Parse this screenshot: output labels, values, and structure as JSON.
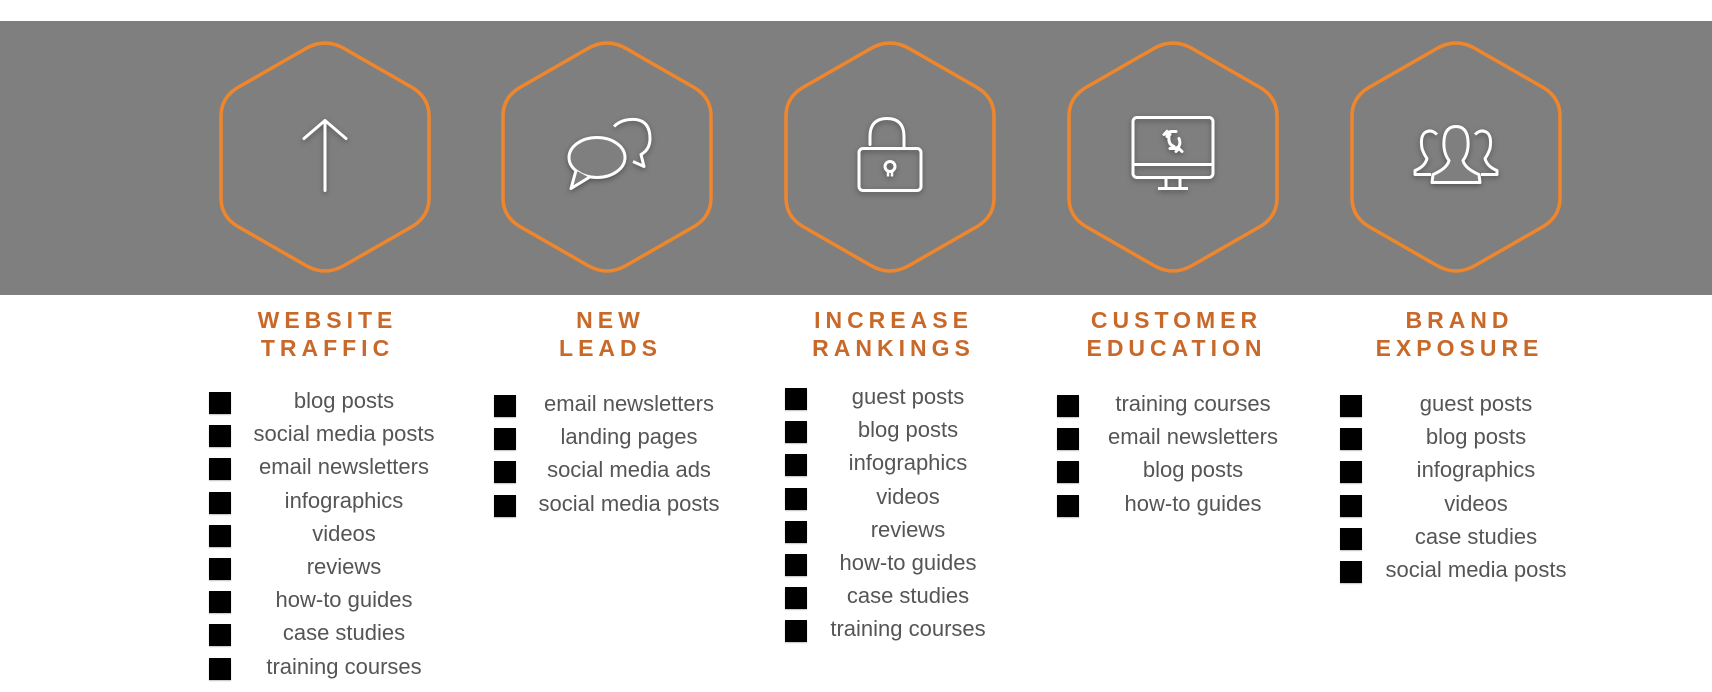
{
  "colors": {
    "band": "#7f7f7f",
    "hex_outline": "#f0862c",
    "title": "#c8692a",
    "item_text": "#555555",
    "bullet": "#000000",
    "icon": "#ffffff"
  },
  "goals": [
    {
      "icon": "arrow-up-icon",
      "title_line1": "WEBSITE",
      "title_line2": "TRAFFIC",
      "items": [
        "blog posts",
        "social media posts",
        "email newsletters",
        "infographics",
        "videos",
        "reviews",
        "how-to guides",
        "case studies",
        "training courses"
      ]
    },
    {
      "icon": "chat-bubbles-icon",
      "title_line1": "NEW",
      "title_line2": "LEADS",
      "items": [
        "email newsletters",
        "landing pages",
        "social media ads",
        "social media posts"
      ]
    },
    {
      "icon": "unlocked-padlock-icon",
      "title_line1": "INCREASE",
      "title_line2": "RANKINGS",
      "items": [
        "guest posts",
        "blog posts",
        "infographics",
        "videos",
        "reviews",
        "how-to guides",
        "case studies",
        "training courses"
      ]
    },
    {
      "icon": "monitor-refresh-icon",
      "title_line1": "CUSTOMER",
      "title_line2": "EDUCATION",
      "items": [
        "training courses",
        "email newsletters",
        "blog posts",
        "how-to guides"
      ]
    },
    {
      "icon": "user-group-icon",
      "title_line1": "BRAND",
      "title_line2": "EXPOSURE",
      "items": [
        "guest posts",
        "blog posts",
        "infographics",
        "videos",
        "case studies",
        "social media posts"
      ]
    }
  ]
}
